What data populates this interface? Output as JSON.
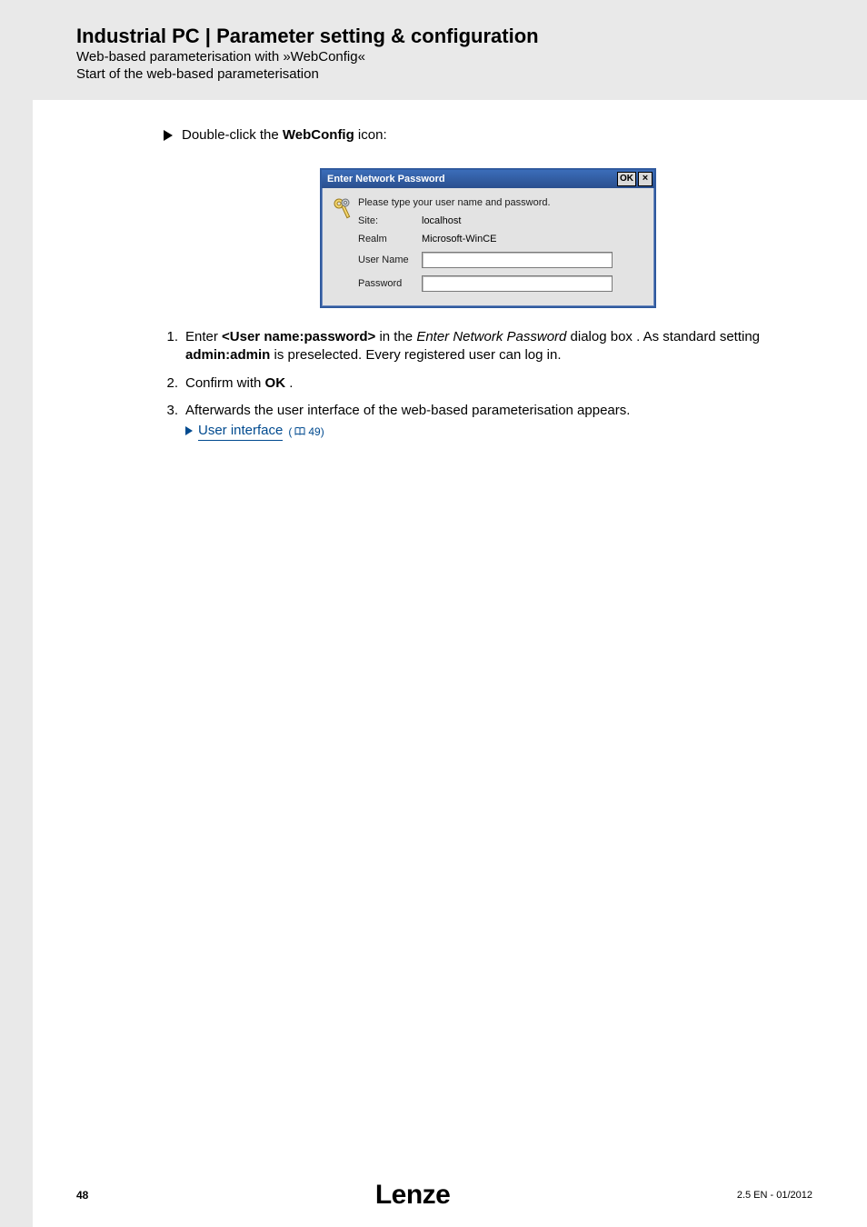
{
  "header": {
    "title": "Industrial PC | Parameter setting & configuration",
    "sub1": "Web-based parameterisation with »WebConfig«",
    "sub2": "Start of the web-based parameterisation"
  },
  "lead": {
    "pre": "Double-click the ",
    "bold": "WebConfig",
    "post": " icon:"
  },
  "dialog": {
    "title": "Enter Network Password",
    "ok": "OK",
    "close": "×",
    "prompt": "Please type your user name and password.",
    "labels": {
      "site": "Site:",
      "realm": "Realm",
      "user": "User Name",
      "pass": "Password"
    },
    "values": {
      "site": "localhost",
      "realm": "Microsoft-WinCE",
      "user": "",
      "pass": ""
    }
  },
  "steps": {
    "s1": {
      "num": "1.",
      "a": "Enter ",
      "b1": "<User name:password>",
      "c": " in the ",
      "i1": "Enter Network Password",
      "d": "  dialog box . As standard setting ",
      "b2": "admin:admin",
      "e": " is preselected. Every registered user can log in."
    },
    "s2": {
      "num": "2.",
      "a": "Confirm with ",
      "b1": "OK",
      "c": " ."
    },
    "s3": {
      "num": "3.",
      "a": "Afterwards the user interface of the web-based parameterisation appears.",
      "link": "User interface",
      "ref": "49)"
    }
  },
  "footer": {
    "page": "48",
    "brand": "Lenze",
    "meta": "2.5 EN - 01/2012"
  }
}
